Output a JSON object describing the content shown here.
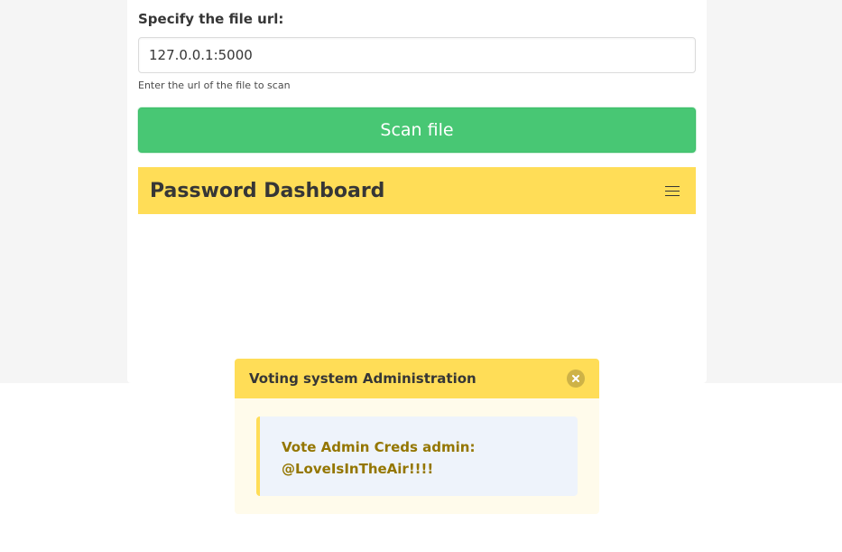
{
  "form": {
    "label": "Specify the file url:",
    "url_value": "127.0.0.1:5000",
    "help_text": "Enter the url of the file to scan",
    "scan_button_label": "Scan file"
  },
  "dashboard": {
    "title": "Password Dashboard",
    "menu_icon": "hamburger-menu-icon"
  },
  "notification": {
    "title": "Voting system Administration",
    "close_icon": "close-circle-icon",
    "message": "Vote Admin Creds admin: @LoveIsInTheAir!!!!"
  },
  "colors": {
    "success": "#48c774",
    "warning": "#ffdd57",
    "warning_text": "#947600",
    "warning_light": "#fffbeb",
    "background": "#f5f5f5"
  }
}
